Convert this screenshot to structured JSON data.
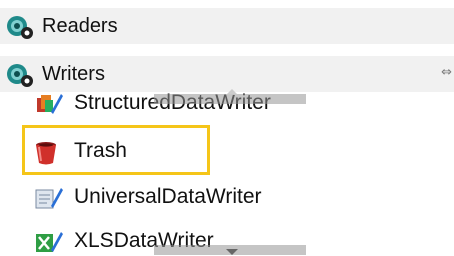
{
  "categories": {
    "readers": {
      "label": "Readers",
      "icon": "readers-gear-icon"
    },
    "writers": {
      "label": "Writers",
      "icon": "writers-gear-icon",
      "collapse_glyph": "⇔"
    }
  },
  "writer_items": [
    {
      "label": "StructuredDataWriter",
      "icon": "structured-writer-icon"
    },
    {
      "label": "Trash",
      "icon": "trash-icon"
    },
    {
      "label": "UniversalDataWriter",
      "icon": "universal-writer-icon"
    },
    {
      "label": "XLSDataWriter",
      "icon": "xls-writer-icon"
    }
  ],
  "highlight": {
    "color": "#f5c518",
    "target": "Trash"
  }
}
